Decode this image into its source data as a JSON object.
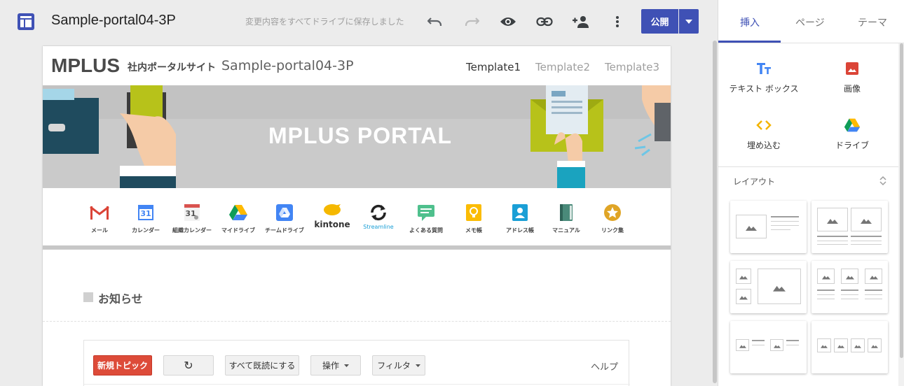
{
  "topbar": {
    "doc_title": "Sample-portal04-3P",
    "save_status": "変更内容をすべてドライブに保存しました",
    "publish_label": "公開"
  },
  "page": {
    "logo_text": "MPLUS",
    "logo_sub": "社内ポータルサイト",
    "site_name": "Sample-portal04-3P",
    "nav": [
      "Template1",
      "Template2",
      "Template3"
    ],
    "banner_title": "MPLUS  PORTAL",
    "apps": [
      {
        "label": "メール",
        "icon": "gmail-icon"
      },
      {
        "label": "カレンダー",
        "icon": "calendar-icon",
        "text": "31"
      },
      {
        "label": "組織カレンダー",
        "icon": "org-calendar-icon",
        "text": "31"
      },
      {
        "label": "マイドライブ",
        "icon": "drive-icon"
      },
      {
        "label": "チームドライブ",
        "icon": "team-drive-icon"
      },
      {
        "label": "",
        "icon": "kintone-icon",
        "text": "kintone"
      },
      {
        "label": "",
        "icon": "streamline-icon",
        "text": "Streamline"
      },
      {
        "label": "よくある質問",
        "icon": "faq-icon"
      },
      {
        "label": "メモ帳",
        "icon": "memo-icon"
      },
      {
        "label": "アドレス帳",
        "icon": "address-book-icon"
      },
      {
        "label": "マニュアル",
        "icon": "manual-icon"
      },
      {
        "label": "リンク集",
        "icon": "links-icon"
      }
    ],
    "news_title": "お知らせ",
    "forum": {
      "new_topic": "新規トピック",
      "refresh": "↻",
      "mark_all_read": "すべて既読にする",
      "actions": "操作",
      "filter": "フィルタ",
      "help": "ヘルプ"
    }
  },
  "panel": {
    "tabs": [
      "挿入",
      "ページ",
      "テーマ"
    ],
    "active_tab": 0,
    "insert_items": [
      {
        "label": "テキスト ボックス",
        "icon": "text-box-icon"
      },
      {
        "label": "画像",
        "icon": "image-icon"
      },
      {
        "label": "埋め込む",
        "icon": "embed-icon"
      },
      {
        "label": "ドライブ",
        "icon": "drive-icon"
      }
    ],
    "layout_heading": "レイアウト"
  },
  "colors": {
    "accent": "#3f51b5",
    "new_topic": "#dd4b39"
  }
}
